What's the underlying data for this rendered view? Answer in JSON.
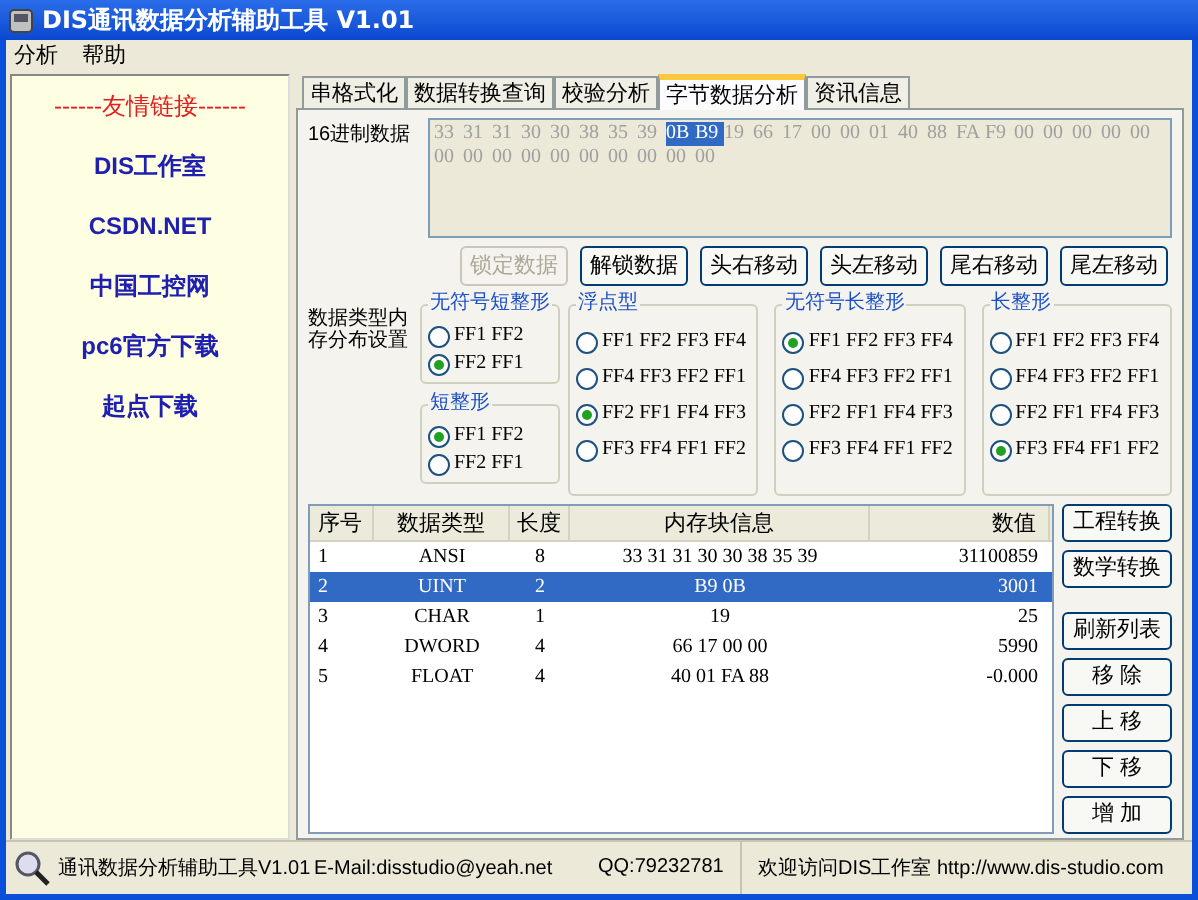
{
  "window": {
    "title": "DIS通讯数据分析辅助工具 V1.01"
  },
  "menu": [
    "分析",
    "帮助"
  ],
  "sidebar": {
    "heading": "------友情链接------",
    "links": [
      "DIS工作室",
      "CSDN.NET",
      "中国工控网",
      "pc6官方下载",
      "起点下载"
    ]
  },
  "tabs": [
    {
      "label": "串格式化",
      "selected": false
    },
    {
      "label": "数据转换查询",
      "selected": false
    },
    {
      "label": "校验分析",
      "selected": false
    },
    {
      "label": "字节数据分析",
      "selected": true
    },
    {
      "label": "资讯信息",
      "selected": false
    }
  ],
  "hex_data": {
    "label": "16进制数据",
    "bytes": [
      {
        "text": "33",
        "selected": false
      },
      {
        "text": "31",
        "selected": false
      },
      {
        "text": "31",
        "selected": false
      },
      {
        "text": "30",
        "selected": false
      },
      {
        "text": "30",
        "selected": false
      },
      {
        "text": "38",
        "selected": false
      },
      {
        "text": "35",
        "selected": false
      },
      {
        "text": "39",
        "selected": false
      },
      {
        "text": "0B",
        "selected": true
      },
      {
        "text": "B9",
        "selected": true
      },
      {
        "text": "19",
        "selected": false
      },
      {
        "text": "66",
        "selected": false
      },
      {
        "text": "17",
        "selected": false
      },
      {
        "text": "00",
        "selected": false
      },
      {
        "text": "00",
        "selected": false
      },
      {
        "text": "01",
        "selected": false
      },
      {
        "text": "40",
        "selected": false
      },
      {
        "text": "88",
        "selected": false
      },
      {
        "text": "FA",
        "selected": false
      },
      {
        "text": "F9",
        "selected": false
      },
      {
        "text": "00",
        "selected": false
      },
      {
        "text": "00",
        "selected": false
      },
      {
        "text": "00",
        "selected": false
      },
      {
        "text": "00",
        "selected": false
      },
      {
        "text": "00",
        "selected": false
      },
      {
        "text": "00",
        "selected": false
      },
      {
        "text": "00",
        "selected": false
      },
      {
        "text": "00",
        "selected": false
      },
      {
        "text": "00",
        "selected": false
      },
      {
        "text": "00",
        "selected": false
      },
      {
        "text": "00",
        "selected": false
      },
      {
        "text": "00",
        "selected": false
      },
      {
        "text": "00",
        "selected": false
      },
      {
        "text": "00",
        "selected": false
      },
      {
        "text": "00",
        "selected": false
      }
    ]
  },
  "hex_buttons": [
    {
      "label": "锁定数据",
      "disabled": true
    },
    {
      "label": "解锁数据",
      "disabled": false
    },
    {
      "label": "头右移动",
      "disabled": false
    },
    {
      "label": "头左移动",
      "disabled": false
    },
    {
      "label": "尾右移动",
      "disabled": false
    },
    {
      "label": "尾左移动",
      "disabled": false
    }
  ],
  "layout_label": "数据类型内存分布设置",
  "groups": [
    {
      "title": "无符号短整形",
      "options": [
        {
          "label": "FF1 FF2",
          "selected": false
        },
        {
          "label": "FF2 FF1",
          "selected": true
        }
      ]
    },
    {
      "title": "短整形",
      "options": [
        {
          "label": "FF1 FF2",
          "selected": true
        },
        {
          "label": "FF2 FF1",
          "selected": false
        }
      ]
    },
    {
      "title": "浮点型",
      "options": [
        {
          "label": "FF1 FF2 FF3 FF4",
          "selected": false
        },
        {
          "label": "FF4 FF3 FF2 FF1",
          "selected": false
        },
        {
          "label": "FF2 FF1 FF4 FF3",
          "selected": true
        },
        {
          "label": "FF3 FF4 FF1 FF2",
          "selected": false
        }
      ]
    },
    {
      "title": "无符号长整形",
      "options": [
        {
          "label": "FF1 FF2 FF3 FF4",
          "selected": true
        },
        {
          "label": "FF4 FF3 FF2 FF1",
          "selected": false
        },
        {
          "label": "FF2 FF1 FF4 FF3",
          "selected": false
        },
        {
          "label": "FF3 FF4 FF1 FF2",
          "selected": false
        }
      ]
    },
    {
      "title": "长整形",
      "options": [
        {
          "label": "FF1 FF2 FF3 FF4",
          "selected": false
        },
        {
          "label": "FF4 FF3 FF2 FF1",
          "selected": false
        },
        {
          "label": "FF2 FF1 FF4 FF3",
          "selected": false
        },
        {
          "label": "FF3 FF4 FF1 FF2",
          "selected": true
        }
      ]
    }
  ],
  "table": {
    "columns": [
      "序号",
      "数据类型",
      "长度",
      "内存块信息",
      "数值"
    ],
    "rows": [
      {
        "cells": [
          "1",
          "ANSI",
          "8",
          "33 31 31 30 30 38 35 39",
          "31100859"
        ],
        "selected": false
      },
      {
        "cells": [
          "2",
          "UINT",
          "2",
          "B9 0B",
          "3001"
        ],
        "selected": true
      },
      {
        "cells": [
          "3",
          "CHAR",
          "1",
          "19",
          "25"
        ],
        "selected": false
      },
      {
        "cells": [
          "4",
          "DWORD",
          "4",
          "66 17 00 00",
          "5990"
        ],
        "selected": false
      },
      {
        "cells": [
          "5",
          "FLOAT",
          "4",
          "40 01 FA 88",
          "-0.000"
        ],
        "selected": false
      }
    ]
  },
  "side_buttons": [
    "工程转换",
    "数学转换",
    "刷新列表",
    "移 除",
    "上 移",
    "下 移",
    "增 加"
  ],
  "status_bar": [
    "通讯数据分析辅助工具V1.01",
    "E-Mail:disstudio@yeah.net",
    "QQ:79232781",
    "欢迎访问DIS工作室 http://www.dis-studio.com"
  ]
}
